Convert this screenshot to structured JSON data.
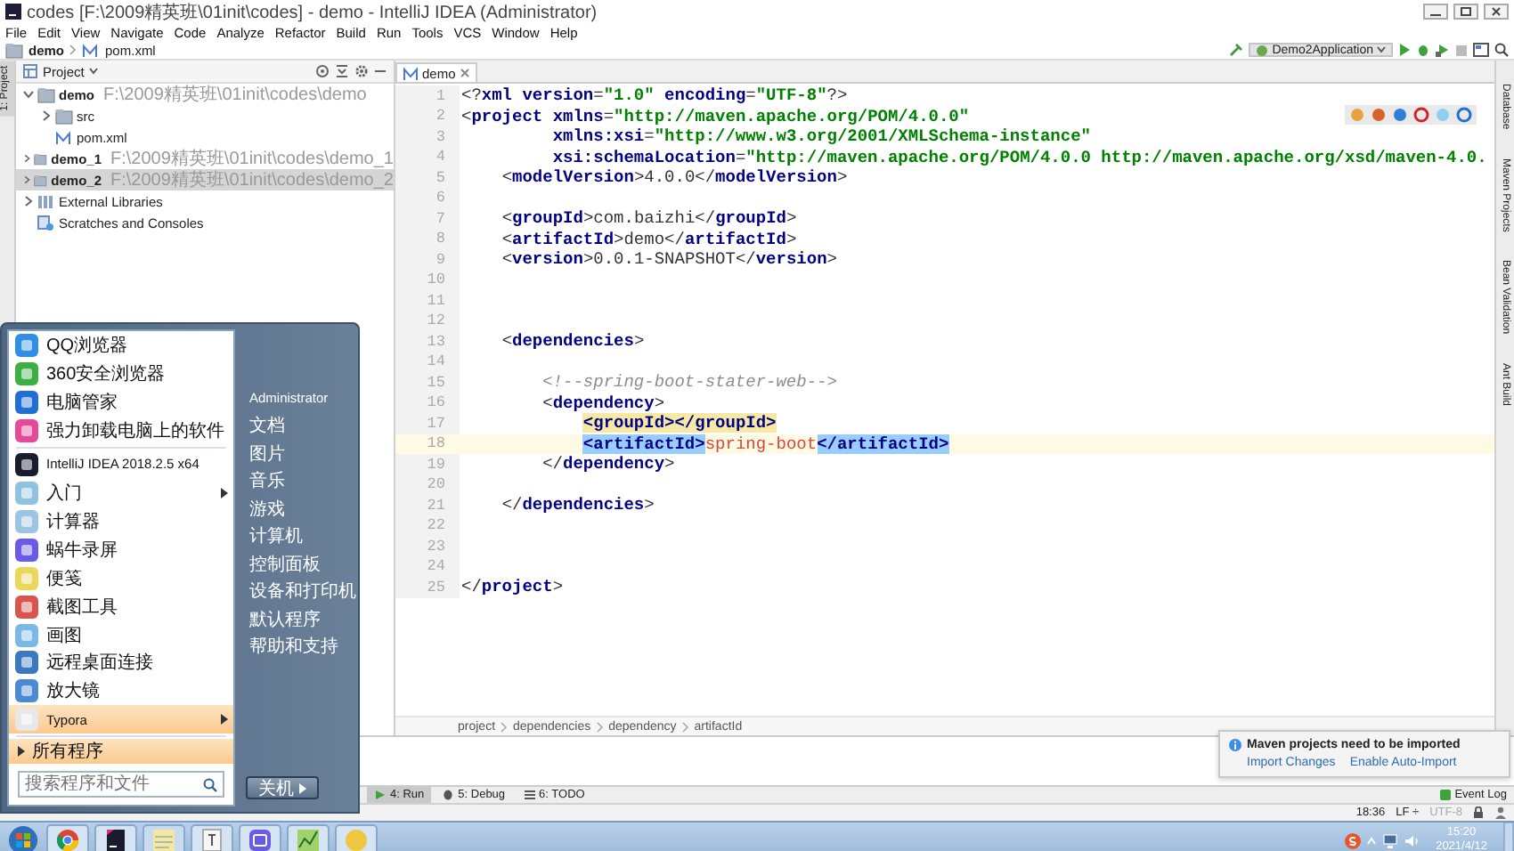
{
  "window": {
    "title": "codes [F:\\2009精英班\\01init\\codes] - demo - IntelliJ IDEA (Administrator)"
  },
  "menu": [
    "File",
    "Edit",
    "View",
    "Navigate",
    "Code",
    "Analyze",
    "Refactor",
    "Build",
    "Run",
    "Tools",
    "VCS",
    "Window",
    "Help"
  ],
  "nav_bar": {
    "crumbs": [
      "demo",
      "pom.xml"
    ],
    "run_config": "Demo2Application"
  },
  "left_strip": [
    "1: Project"
  ],
  "project_panel": {
    "title": "Project",
    "tree": [
      {
        "label": "demo",
        "path": "F:\\2009精英班\\01init\\codes\\demo",
        "kind": "module",
        "expanded": true,
        "selected": false,
        "children": [
          {
            "label": "src",
            "kind": "folder",
            "expanded": false,
            "selected": false
          },
          {
            "label": "pom.xml",
            "kind": "maven",
            "selected": false
          }
        ]
      },
      {
        "label": "demo_1",
        "path": "F:\\2009精英班\\01init\\codes\\demo_1",
        "kind": "module",
        "expanded": false,
        "selected": false
      },
      {
        "label": "demo_2",
        "path": "F:\\2009精英班\\01init\\codes\\demo_2",
        "kind": "module",
        "expanded": false,
        "selected": true
      },
      {
        "label": "External Libraries",
        "kind": "library",
        "expanded": false,
        "selected": false
      },
      {
        "label": "Scratches and Consoles",
        "kind": "scratch",
        "selected": false
      }
    ]
  },
  "editor": {
    "tab": "demo",
    "lines": [
      {
        "number": "1",
        "current": false,
        "tokens": [
          {
            "text": "<?",
            "kind": "p"
          },
          {
            "text": "xml version",
            "kind": "tag"
          },
          {
            "text": "=",
            "kind": "p"
          },
          {
            "text": "\"1.0\"",
            "kind": "val"
          },
          {
            "text": " encoding",
            "kind": "attr"
          },
          {
            "text": "=",
            "kind": "p"
          },
          {
            "text": "\"UTF-8\"",
            "kind": "val"
          },
          {
            "text": "?>",
            "kind": "p"
          }
        ]
      },
      {
        "number": "2",
        "current": false,
        "tokens": [
          {
            "text": "<",
            "kind": "p"
          },
          {
            "text": "project",
            "kind": "tag"
          },
          {
            "text": " xmlns",
            "kind": "attr"
          },
          {
            "text": "=",
            "kind": "p"
          },
          {
            "text": "\"http://maven.apache.org/POM/4.0.0\"",
            "kind": "val"
          }
        ]
      },
      {
        "number": "3",
        "current": false,
        "tokens": [
          {
            "text": "         xmlns:xsi",
            "kind": "attr"
          },
          {
            "text": "=",
            "kind": "p"
          },
          {
            "text": "\"http://www.w3.org/2001/XMLSchema-instance\"",
            "kind": "val"
          }
        ]
      },
      {
        "number": "4",
        "current": false,
        "tokens": [
          {
            "text": "         xsi:schemaLocation",
            "kind": "attr"
          },
          {
            "text": "=",
            "kind": "p"
          },
          {
            "text": "\"http://maven.apache.org/POM/4.0.0 http://maven.apache.org/xsd/maven-4.0.",
            "kind": "val"
          }
        ]
      },
      {
        "number": "5",
        "current": false,
        "tokens": [
          {
            "text": "    <",
            "kind": "p"
          },
          {
            "text": "modelVersion",
            "kind": "tag"
          },
          {
            "text": ">4.0.0</",
            "kind": "p"
          },
          {
            "text": "modelVersion",
            "kind": "tag"
          },
          {
            "text": ">",
            "kind": "p"
          }
        ]
      },
      {
        "number": "6",
        "current": false
      },
      {
        "number": "7",
        "current": false,
        "tokens": [
          {
            "text": "    <",
            "kind": "p"
          },
          {
            "text": "groupId",
            "kind": "tag"
          },
          {
            "text": ">com.baizhi</",
            "kind": "p"
          },
          {
            "text": "groupId",
            "kind": "tag"
          },
          {
            "text": ">",
            "kind": "p"
          }
        ]
      },
      {
        "number": "8",
        "current": false,
        "tokens": [
          {
            "text": "    <",
            "kind": "p"
          },
          {
            "text": "artifactId",
            "kind": "tag"
          },
          {
            "text": ">demo</",
            "kind": "p"
          },
          {
            "text": "artifactId",
            "kind": "tag"
          },
          {
            "text": ">",
            "kind": "p"
          }
        ]
      },
      {
        "number": "9",
        "current": false,
        "tokens": [
          {
            "text": "    <",
            "kind": "p"
          },
          {
            "text": "version",
            "kind": "tag"
          },
          {
            "text": ">0.0.1-SNAPSHOT</",
            "kind": "p"
          },
          {
            "text": "version",
            "kind": "tag"
          },
          {
            "text": ">",
            "kind": "p"
          }
        ]
      },
      {
        "number": "10",
        "current": false
      },
      {
        "number": "11",
        "current": false
      },
      {
        "number": "12",
        "current": false
      },
      {
        "number": "13",
        "current": false,
        "tokens": [
          {
            "text": "    <",
            "kind": "p"
          },
          {
            "text": "dependencies",
            "kind": "tag"
          },
          {
            "text": ">",
            "kind": "p"
          }
        ]
      },
      {
        "number": "14",
        "current": false
      },
      {
        "number": "15",
        "current": false,
        "tokens": [
          {
            "text": "        <!--spring-boot-stater-web-->",
            "kind": "comment"
          }
        ]
      },
      {
        "number": "16",
        "current": false,
        "tokens": [
          {
            "text": "        <",
            "kind": "p"
          },
          {
            "text": "dependency",
            "kind": "tag"
          },
          {
            "text": ">",
            "kind": "p"
          }
        ]
      },
      {
        "number": "17",
        "current": false,
        "tokens": [
          {
            "text": "            <groupId>",
            "kind": "pair"
          },
          {
            "text": "</groupId>",
            "kind": "pair"
          }
        ]
      },
      {
        "number": "18",
        "current": true,
        "tokens": [
          {
            "text": "            <artifactId>",
            "kind": "match"
          },
          {
            "text": "spring-boot",
            "kind": "err"
          },
          {
            "text": "</artifactId>",
            "kind": "match"
          }
        ]
      },
      {
        "number": "19",
        "current": false,
        "tokens": [
          {
            "text": "        </",
            "kind": "p"
          },
          {
            "text": "dependency",
            "kind": "tag"
          },
          {
            "text": ">",
            "kind": "p"
          }
        ]
      },
      {
        "number": "20",
        "current": false
      },
      {
        "number": "21",
        "current": false,
        "tokens": [
          {
            "text": "    </",
            "kind": "p"
          },
          {
            "text": "dependencies",
            "kind": "tag"
          },
          {
            "text": ">",
            "kind": "p"
          }
        ]
      },
      {
        "number": "22",
        "current": false
      },
      {
        "number": "23",
        "current": false
      },
      {
        "number": "24",
        "current": false
      },
      {
        "number": "25",
        "current": false,
        "tokens": [
          {
            "text": "</",
            "kind": "p"
          },
          {
            "text": "project",
            "kind": "tag"
          },
          {
            "text": ">",
            "kind": "p"
          }
        ]
      }
    ],
    "breadcrumbs": [
      "project",
      "dependencies",
      "dependency",
      "artifactId"
    ]
  },
  "right_strip": [
    "Database",
    "Maven Projects",
    "Bean Validation",
    "Ant Build"
  ],
  "notification": {
    "title": "Maven projects need to be imported",
    "links": [
      "Import Changes",
      "Enable Auto-Import"
    ]
  },
  "tool_tabs": [
    {
      "label": "4: Run",
      "selected": true
    },
    {
      "label": "5: Debug",
      "selected": false
    },
    {
      "label": "6: TODO",
      "selected": false
    }
  ],
  "event_log": "Event Log",
  "status_bar": {
    "position": "18:36",
    "line_separator": "LF ÷",
    "encoding": "UTF-8"
  },
  "start_menu": {
    "pinned": [
      {
        "label": "QQ浏览器",
        "color": "#2f8fe6",
        "submenu": false,
        "selected": false
      },
      {
        "label": "360安全浏览器",
        "color": "#3cb043",
        "submenu": false,
        "selected": false
      },
      {
        "label": "电脑管家",
        "color": "#1f6fd6",
        "submenu": false,
        "selected": false
      },
      {
        "label": "强力卸载电脑上的软件",
        "color": "#e8489a",
        "submenu": false,
        "selected": false
      }
    ],
    "recent": [
      {
        "label": "IntelliJ IDEA 2018.2.5 x64",
        "color": "#1b1b2f",
        "submenu": false,
        "selected": false
      },
      {
        "label": "入门",
        "color": "#8fc3e0",
        "submenu": true,
        "selected": false
      },
      {
        "label": "计算器",
        "color": "#9cc4e4",
        "submenu": false,
        "selected": false
      },
      {
        "label": "蜗牛录屏",
        "color": "#6a5ae8",
        "submenu": false,
        "selected": false
      },
      {
        "label": "便笺",
        "color": "#e9d85a",
        "submenu": false,
        "selected": false
      },
      {
        "label": "截图工具",
        "color": "#d9534f",
        "submenu": false,
        "selected": false
      },
      {
        "label": "画图",
        "color": "#7bb8e8",
        "submenu": false,
        "selected": false
      },
      {
        "label": "远程桌面连接",
        "color": "#3a78c2",
        "submenu": false,
        "selected": false
      },
      {
        "label": "放大镜",
        "color": "#4a8ad4",
        "submenu": false,
        "selected": false
      },
      {
        "label": "Typora",
        "color": "#e8e8e8",
        "submenu": true,
        "selected": true
      }
    ],
    "all_programs": "所有程序",
    "search": {
      "placeholder": "搜索程序和文件"
    },
    "places": [
      "Administrator",
      "文档",
      "图片",
      "音乐",
      "游戏",
      "计算机",
      "控制面板",
      "设备和打印机",
      "默认程序",
      "帮助和支持"
    ],
    "shutdown": "关机"
  },
  "clock": {
    "time": "15:20",
    "date": "2021/4/12"
  }
}
